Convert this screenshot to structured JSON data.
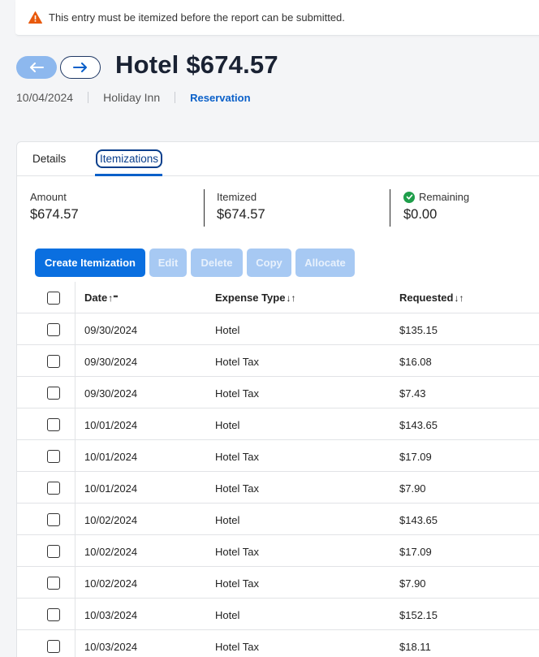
{
  "alert": {
    "message": "This entry must be itemized before the report can be submitted."
  },
  "header": {
    "title": "Hotel $674.57",
    "date": "10/04/2024",
    "vendor": "Holiday Inn",
    "link": "Reservation"
  },
  "tabs": [
    {
      "label": "Details"
    },
    {
      "label": "Itemizations"
    }
  ],
  "summary": {
    "amount_label": "Amount",
    "amount_value": "$674.57",
    "itemized_label": "Itemized",
    "itemized_value": "$674.57",
    "remaining_label": "Remaining",
    "remaining_value": "$0.00"
  },
  "toolbar": {
    "create": "Create Itemization",
    "edit": "Edit",
    "delete": "Delete",
    "copy": "Copy",
    "allocate": "Allocate"
  },
  "table": {
    "columns": {
      "date": "Date",
      "type": "Expense Type",
      "requested": "Requested"
    },
    "rows": [
      {
        "date": "09/30/2024",
        "type": "Hotel",
        "amount": "$135.15"
      },
      {
        "date": "09/30/2024",
        "type": "Hotel Tax",
        "amount": "$16.08"
      },
      {
        "date": "09/30/2024",
        "type": "Hotel Tax",
        "amount": "$7.43"
      },
      {
        "date": "10/01/2024",
        "type": "Hotel",
        "amount": "$143.65"
      },
      {
        "date": "10/01/2024",
        "type": "Hotel Tax",
        "amount": "$17.09"
      },
      {
        "date": "10/01/2024",
        "type": "Hotel Tax",
        "amount": "$7.90"
      },
      {
        "date": "10/02/2024",
        "type": "Hotel",
        "amount": "$143.65"
      },
      {
        "date": "10/02/2024",
        "type": "Hotel Tax",
        "amount": "$17.09"
      },
      {
        "date": "10/02/2024",
        "type": "Hotel Tax",
        "amount": "$7.90"
      },
      {
        "date": "10/03/2024",
        "type": "Hotel",
        "amount": "$152.15"
      },
      {
        "date": "10/03/2024",
        "type": "Hotel Tax",
        "amount": "$18.11"
      }
    ]
  },
  "colors": {
    "primary": "#0a6fe0",
    "disabled": "#a7c9f3",
    "warning": "#e8590c",
    "success": "#1e9e4a"
  }
}
